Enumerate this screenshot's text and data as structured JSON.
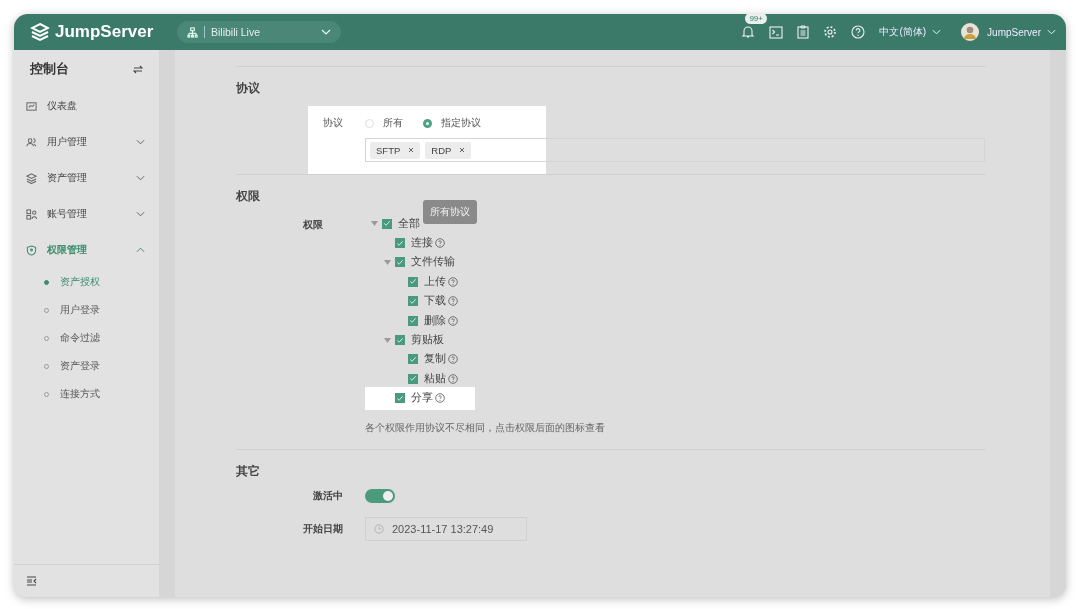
{
  "header": {
    "logo": "JumpServer",
    "org_selector": "Bilibili Live",
    "notification_badge": "99+",
    "language": "中文(简体)",
    "user": "JumpServer"
  },
  "sidebar": {
    "title": "控制台",
    "items": [
      {
        "label": "仪表盘",
        "kind": "link",
        "selected": false
      },
      {
        "label": "用户管理",
        "kind": "group",
        "expanded": false,
        "selected": false
      },
      {
        "label": "资产管理",
        "kind": "group",
        "expanded": false,
        "selected": false
      },
      {
        "label": "账号管理",
        "kind": "group",
        "expanded": false,
        "selected": false
      },
      {
        "label": "权限管理",
        "kind": "group",
        "expanded": true,
        "selected": true,
        "children": [
          {
            "label": "资产授权",
            "selected": true
          },
          {
            "label": "用户登录",
            "selected": false
          },
          {
            "label": "命令过滤",
            "selected": false
          },
          {
            "label": "资产登录",
            "selected": false
          },
          {
            "label": "连接方式",
            "selected": false
          }
        ]
      }
    ]
  },
  "protocol": {
    "title": "协议",
    "label": "协议",
    "highlighted": true,
    "options": [
      {
        "label": "所有",
        "selected": false
      },
      {
        "label": "指定协议",
        "selected": true
      }
    ],
    "tags": [
      "SFTP",
      "RDP"
    ]
  },
  "permissions": {
    "title": "权限",
    "label": "权限",
    "tooltip": "所有协议",
    "tree": [
      {
        "label": "全部",
        "checked": true,
        "help": false,
        "highlighted": false,
        "expanded": true,
        "children": [
          {
            "label": "连接",
            "checked": true,
            "help": true,
            "highlighted": false
          },
          {
            "label": "文件传输",
            "checked": true,
            "help": false,
            "highlighted": false,
            "expanded": true,
            "children": [
              {
                "label": "上传",
                "checked": true,
                "help": true,
                "highlighted": false
              },
              {
                "label": "下载",
                "checked": true,
                "help": true,
                "highlighted": false
              },
              {
                "label": "删除",
                "checked": true,
                "help": true,
                "highlighted": false
              }
            ]
          },
          {
            "label": "剪贴板",
            "checked": true,
            "help": false,
            "highlighted": false,
            "expanded": true,
            "children": [
              {
                "label": "复制",
                "checked": true,
                "help": true,
                "highlighted": false
              },
              {
                "label": "粘贴",
                "checked": true,
                "help": true,
                "highlighted": false
              }
            ]
          },
          {
            "label": "分享",
            "checked": true,
            "help": true,
            "highlighted": true
          }
        ]
      }
    ],
    "hint": "各个权限作用协议不尽相同，点击权限后面的图标查看"
  },
  "other": {
    "title": "其它",
    "active": {
      "label": "激活中",
      "on": true
    },
    "start_date": {
      "label": "开始日期",
      "value": "2023-11-17 13:27:49"
    }
  }
}
